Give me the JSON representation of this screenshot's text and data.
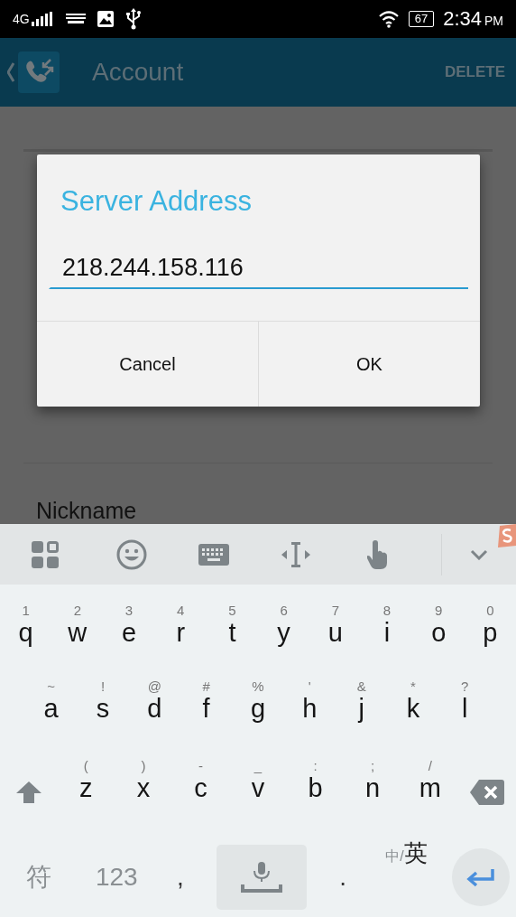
{
  "status_bar": {
    "network": "4G",
    "battery": "67",
    "time": "2:34",
    "ampm": "PM"
  },
  "app_bar": {
    "title": "Account",
    "action": "DELETE"
  },
  "background_list": {
    "items": [
      {
        "label": "Nickname"
      }
    ]
  },
  "dialog": {
    "title": "Server Address",
    "field": {
      "value": "218.244.158.116"
    },
    "buttons": [
      "Cancel",
      "OK"
    ]
  },
  "keyboard": {
    "toolbar": [
      {
        "kind": "apps"
      },
      {
        "kind": "emoji"
      },
      {
        "kind": "keyboard"
      },
      {
        "kind": "cursor"
      },
      {
        "kind": "gesture"
      },
      {
        "kind": "collapse"
      }
    ],
    "rows": [
      {
        "keys": [
          {
            "kind": "char",
            "hint": "1",
            "label": "q"
          },
          {
            "kind": "char",
            "hint": "2",
            "label": "w"
          },
          {
            "kind": "char",
            "hint": "3",
            "label": "e"
          },
          {
            "kind": "char",
            "hint": "4",
            "label": "r"
          },
          {
            "kind": "char",
            "hint": "5",
            "label": "t"
          },
          {
            "kind": "char",
            "hint": "6",
            "label": "y"
          },
          {
            "kind": "char",
            "hint": "7",
            "label": "u"
          },
          {
            "kind": "char",
            "hint": "8",
            "label": "i"
          },
          {
            "kind": "char",
            "hint": "9",
            "label": "o"
          },
          {
            "kind": "char",
            "hint": "0",
            "label": "p"
          }
        ]
      },
      {
        "keys": [
          {
            "kind": "char",
            "hint": "~",
            "label": "a"
          },
          {
            "kind": "char",
            "hint": "!",
            "label": "s"
          },
          {
            "kind": "char",
            "hint": "@",
            "label": "d"
          },
          {
            "kind": "char",
            "hint": "#",
            "label": "f"
          },
          {
            "kind": "char",
            "hint": "%",
            "label": "g"
          },
          {
            "kind": "char",
            "hint": "'",
            "label": "h"
          },
          {
            "kind": "char",
            "hint": "&",
            "label": "j"
          },
          {
            "kind": "char",
            "hint": "*",
            "label": "k"
          },
          {
            "kind": "char",
            "hint": "?",
            "label": "l"
          }
        ]
      },
      {
        "keys": [
          {
            "kind": "shift"
          },
          {
            "kind": "char",
            "hint": "(",
            "label": "z"
          },
          {
            "kind": "char",
            "hint": ")",
            "label": "x"
          },
          {
            "kind": "char",
            "hint": "-",
            "label": "c"
          },
          {
            "kind": "char",
            "hint": "_",
            "label": "v"
          },
          {
            "kind": "char",
            "hint": ":",
            "label": "b"
          },
          {
            "kind": "char",
            "hint": ";",
            "label": "n"
          },
          {
            "kind": "char",
            "hint": "/",
            "label": "m"
          },
          {
            "kind": "backspace"
          }
        ]
      }
    ],
    "bottom_row": {
      "keys": [
        {
          "kind": "func",
          "label": "符"
        },
        {
          "kind": "func",
          "label": "123"
        },
        {
          "kind": "punct",
          "label": ","
        },
        {
          "kind": "space"
        },
        {
          "kind": "punct",
          "label": "."
        },
        {
          "kind": "lang",
          "hint": "中/",
          "label": "英"
        },
        {
          "kind": "enter"
        }
      ]
    }
  }
}
